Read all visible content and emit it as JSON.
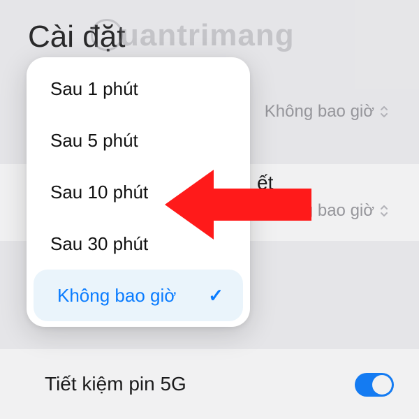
{
  "page": {
    "title": "Cài đặt"
  },
  "watermark": {
    "text": "uantrimang"
  },
  "rows": {
    "row1_value": "Không bao giờ",
    "row2_partial_label": "ết",
    "row2_value": "Không bao giờ",
    "row3_label": "Tiết kiệm pin 5G"
  },
  "dropdown": {
    "items": [
      {
        "label": "Sau 1 phút",
        "selected": false
      },
      {
        "label": "Sau 5 phút",
        "selected": false
      },
      {
        "label": "Sau 10 phút",
        "selected": false
      },
      {
        "label": "Sau 30 phút",
        "selected": false
      },
      {
        "label": "Không bao giờ",
        "selected": true
      }
    ]
  },
  "icons": {
    "check": "✓"
  }
}
